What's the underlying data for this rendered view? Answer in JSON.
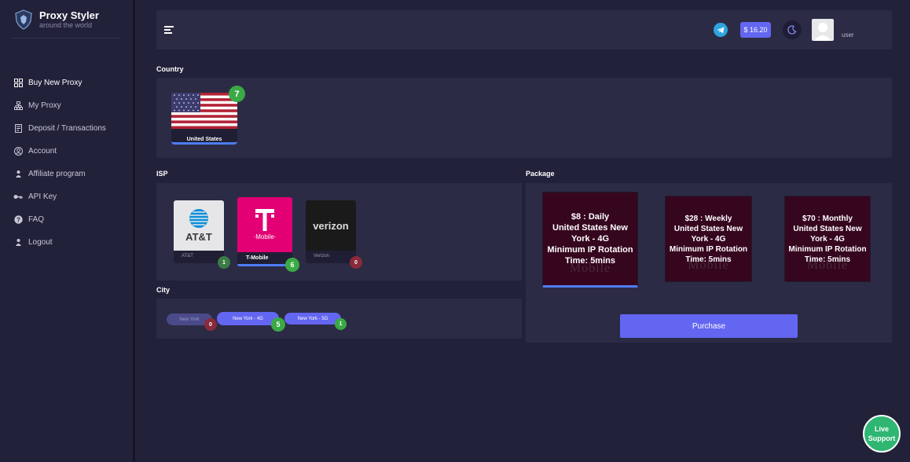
{
  "brand": {
    "title": "Proxy Styler",
    "subtitle": "around the world"
  },
  "nav": [
    {
      "label": "Buy New Proxy",
      "icon": "grid-icon",
      "active": true
    },
    {
      "label": "My Proxy",
      "icon": "network-icon"
    },
    {
      "label": "Deposit / Transactions",
      "icon": "receipt-icon"
    },
    {
      "label": "Account",
      "icon": "user-circle-icon"
    },
    {
      "label": "Affiliate program",
      "icon": "affiliate-icon"
    },
    {
      "label": "API Key",
      "icon": "key-icon"
    },
    {
      "label": "FAQ",
      "icon": "question-icon"
    },
    {
      "label": "Logout",
      "icon": "logout-icon"
    }
  ],
  "header": {
    "balance": "$ 16.20",
    "username": "user"
  },
  "sections": {
    "country": "Country",
    "isp": "ISP",
    "city": "City",
    "package": "Package"
  },
  "country": {
    "name": "United States",
    "count": "7"
  },
  "isps": [
    {
      "name": "AT&T",
      "logo_text": "AT&T",
      "count": "1"
    },
    {
      "name": "T-Mobile",
      "logo_text": "·Mobile·",
      "count": "6"
    },
    {
      "name": "Verizon",
      "logo_text": "verizon",
      "count": "0"
    }
  ],
  "cities": [
    {
      "name": "New York",
      "count": "0"
    },
    {
      "name": "New York - 4G",
      "count": "5"
    },
    {
      "name": "New York - 5G",
      "count": "1"
    }
  ],
  "packages": [
    {
      "lines": [
        "$8 : Daily",
        "United States New",
        "York - 4G",
        "Minimum IP Rotation",
        "Time: 5mins"
      ]
    },
    {
      "lines": [
        "$28 : Weekly",
        "United States New",
        "York - 4G",
        "Minimum IP Rotation",
        "Time: 5mins"
      ]
    },
    {
      "lines": [
        "$70 : Monthly",
        "United States New",
        "York - 4G",
        "Minimum IP Rotation",
        "Time: 5mins"
      ]
    }
  ],
  "package_watermark": "Mobile",
  "purchase_label": "Purchase",
  "live_support": {
    "line1": "Live",
    "line2": "Support"
  },
  "colors": {
    "accent": "#6366f1",
    "bg": "#22213a",
    "panel": "#2c2b45",
    "tmobile": "#e20074",
    "package_bg": "#36061f",
    "badge_green": "#3aaa45"
  }
}
